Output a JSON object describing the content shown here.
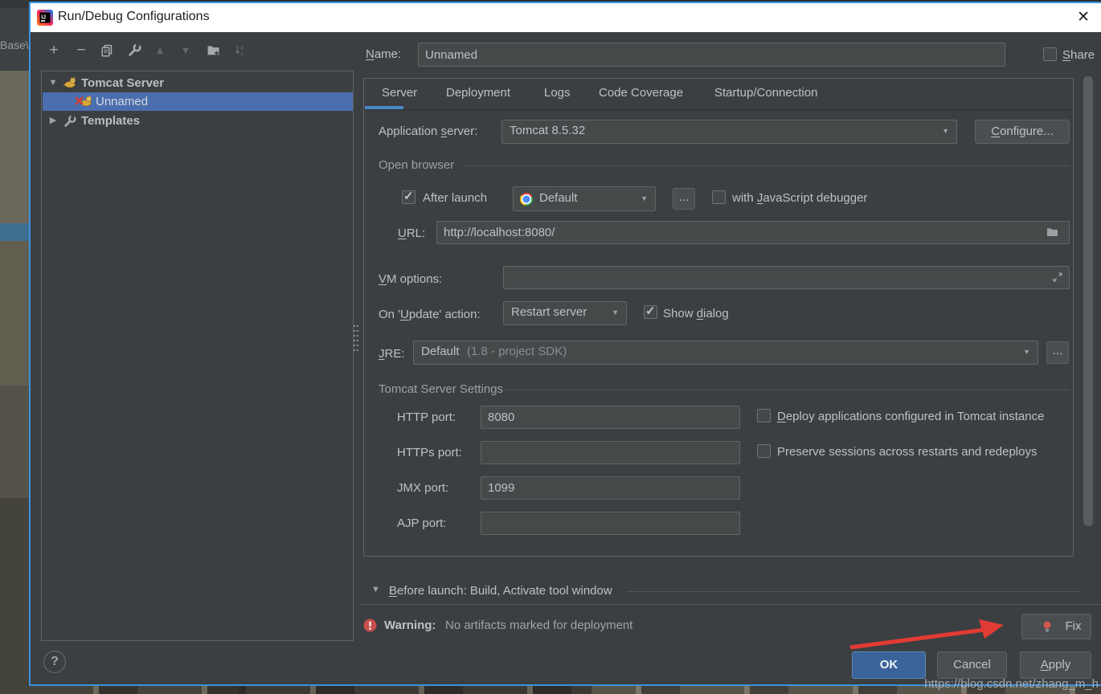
{
  "window": {
    "title": "Run/Debug Configurations",
    "close_glyph": "✕"
  },
  "background": {
    "left_text": "Base\\"
  },
  "toolbar": {
    "items": [
      {
        "name": "add",
        "glyph": "+",
        "enabled": true
      },
      {
        "name": "remove",
        "glyph": "−",
        "enabled": true
      },
      {
        "name": "copy-configuration",
        "glyph": "",
        "enabled": true
      },
      {
        "name": "edit-defaults",
        "glyph": "",
        "enabled": true
      },
      {
        "name": "move-up",
        "glyph": "▲",
        "enabled": false
      },
      {
        "name": "move-down",
        "glyph": "▼",
        "enabled": false
      },
      {
        "name": "new-folder",
        "glyph": "",
        "enabled": true
      },
      {
        "name": "sort-configurations",
        "glyph": "",
        "enabled": false
      }
    ]
  },
  "tree": {
    "root": {
      "label": "Tomcat Server",
      "expanded_glyph": "▼"
    },
    "selected": {
      "label": "Unnamed"
    },
    "templates": {
      "label": "Templates",
      "collapsed_glyph": "▶"
    }
  },
  "name_row": {
    "label": "Name:",
    "value": "Unnamed",
    "share_label": "Share",
    "share_checked": false
  },
  "tabs": {
    "active_index": 0,
    "items": [
      {
        "label": "Server"
      },
      {
        "label": "Deployment"
      },
      {
        "label": "Logs"
      },
      {
        "label": "Code Coverage"
      },
      {
        "label": "Startup/Connection"
      }
    ]
  },
  "server_tab": {
    "application_server": {
      "label": "Application server:",
      "value": "Tomcat 8.5.32",
      "configure_label": "Configure..."
    },
    "open_browser": {
      "group_label": "Open browser",
      "after_launch_label": "After launch",
      "after_launch_checked": true,
      "browser_value": "Default",
      "more_label": "...",
      "js_debugger_label": "with JavaScript debugger",
      "js_debugger_checked": false,
      "url_label": "URL:",
      "url_value": "http://localhost:8080/"
    },
    "vm_options": {
      "label": "VM options:",
      "value": ""
    },
    "on_update": {
      "label": "On 'Update' action:",
      "value": "Restart server",
      "show_dialog_label": "Show dialog",
      "show_dialog_checked": true
    },
    "jre": {
      "label": "JRE:",
      "value": "Default",
      "value_hint": "(1.8 - project SDK)",
      "more_label": "..."
    },
    "tomcat_settings": {
      "group_label": "Tomcat Server Settings",
      "http_port": {
        "label": "HTTP port:",
        "value": "8080"
      },
      "https_port": {
        "label": "HTTPs port:",
        "value": ""
      },
      "jmx_port": {
        "label": "JMX port:",
        "value": "1099"
      },
      "ajp_port": {
        "label": "AJP port:",
        "value": ""
      },
      "deploy_label": "Deploy applications configured in Tomcat instance",
      "deploy_checked": false,
      "preserve_label": "Preserve sessions across restarts and redeploys",
      "preserve_checked": false
    }
  },
  "before_launch": {
    "collapse_glyph": "▼",
    "label": "Before launch: Build, Activate tool window"
  },
  "warning": {
    "prefix": "Warning:",
    "text": "No artifacts marked for deployment",
    "fix_label": "Fix"
  },
  "dialog_buttons": {
    "ok": "OK",
    "cancel": "Cancel",
    "apply": "Apply",
    "help": "?"
  },
  "watermark": "https://blog.csdn.net/zhang_m_h",
  "colors": {
    "dialog_bg": "#3c3f41",
    "selection_blue": "#4b6eaf",
    "tab_underline": "#4a88c7",
    "focus_border": "#3c92dc",
    "warning_red": "#c7504b",
    "ok_button_blue": "#3a639a",
    "annotation_arrow_red": "#e23b34",
    "titlebar_bg": "#ffffff"
  }
}
